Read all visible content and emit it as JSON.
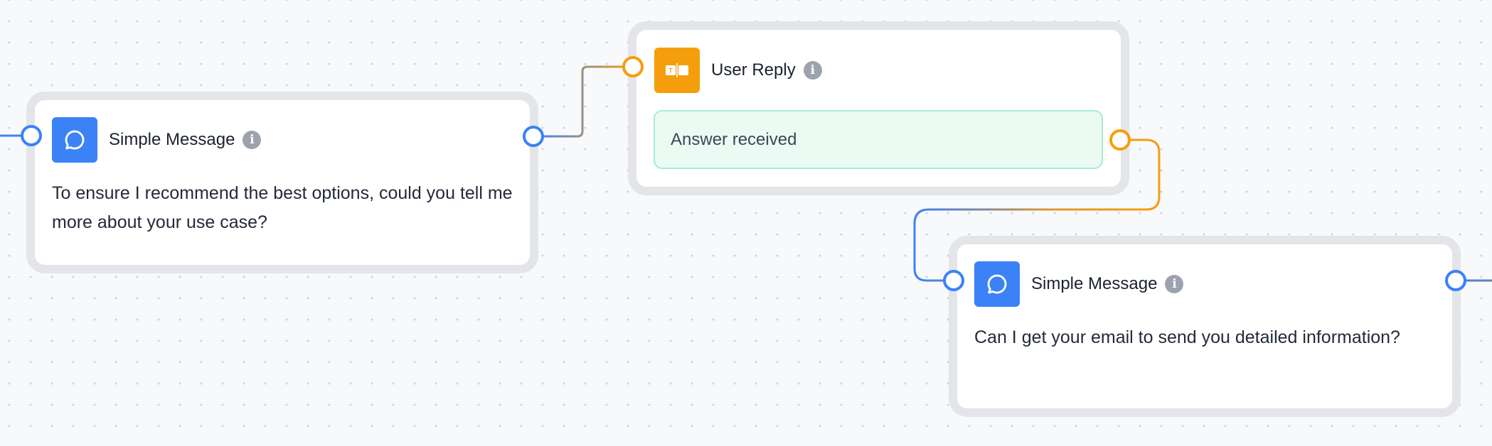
{
  "canvas": {
    "colors": {
      "message_accent": "#3b82f6",
      "reply_accent": "#f59e0b",
      "answer_bg": "#ebfbf3",
      "answer_border": "#a7ecd0",
      "info_icon": "#9ca3af"
    }
  },
  "nodes": [
    {
      "type": "simple-message",
      "icon": "chat-bubble-icon",
      "title": "Simple Message",
      "info_icon": "info-icon",
      "info_glyph": "i",
      "message": "To ensure I recommend the best options, could you tell me more about your use case?"
    },
    {
      "type": "user-reply",
      "icon": "text-input-icon",
      "title": "User Reply",
      "info_icon": "info-icon",
      "info_glyph": "i",
      "output_label": "Answer received"
    },
    {
      "type": "simple-message",
      "icon": "chat-bubble-icon",
      "title": "Simple Message",
      "info_icon": "info-icon",
      "info_glyph": "i",
      "message": "Can I get your email to send you detailed information?"
    }
  ],
  "edges": [
    {
      "from": "incoming",
      "to": "simple-message-1"
    },
    {
      "from": "simple-message-1",
      "to": "user-reply"
    },
    {
      "from": "user-reply",
      "to": "simple-message-2"
    },
    {
      "from": "simple-message-2",
      "to": "outgoing"
    }
  ]
}
